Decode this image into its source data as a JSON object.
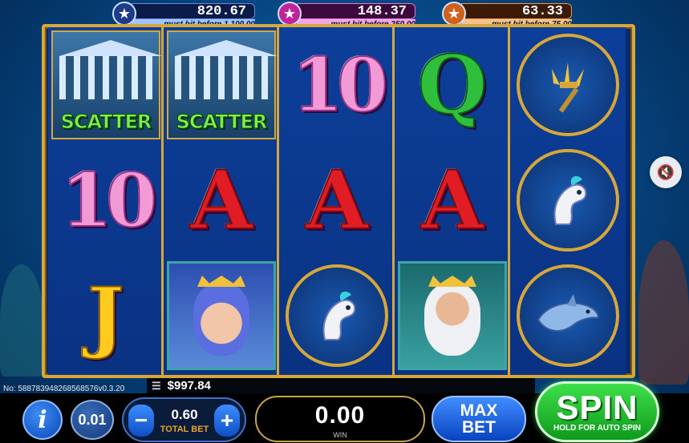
{
  "jackpots": [
    {
      "value": "820.67",
      "sub": "must hit before 1,100.00",
      "color": "#1e3c8c",
      "bar": "#0b1b4a"
    },
    {
      "value": "148.37",
      "sub": "must hit before 250.00",
      "color": "#c0249c",
      "bar": "#3a0a3c"
    },
    {
      "value": "63.33",
      "sub": "must hit before 75.00",
      "color": "#d0601c",
      "bar": "#3c1a06"
    }
  ],
  "reels": [
    [
      {
        "type": "scatter",
        "label": "SCATTER",
        "icon": "temple-icon"
      },
      {
        "type": "letter",
        "value": "10"
      },
      {
        "type": "letter",
        "value": "J"
      }
    ],
    [
      {
        "type": "scatter",
        "label": "SCATTER",
        "icon": "temple-icon"
      },
      {
        "type": "letter",
        "value": "A"
      },
      {
        "type": "portrait",
        "icon": "goddess-icon"
      }
    ],
    [
      {
        "type": "letter",
        "value": "10"
      },
      {
        "type": "letter",
        "value": "A"
      },
      {
        "type": "medallion",
        "icon": "seahorse-icon"
      }
    ],
    [
      {
        "type": "letter",
        "value": "Q"
      },
      {
        "type": "letter",
        "value": "A"
      },
      {
        "type": "portrait",
        "icon": "poseidon-icon"
      }
    ],
    [
      {
        "type": "medallion",
        "icon": "trident-icon"
      },
      {
        "type": "medallion",
        "icon": "seahorse-icon"
      },
      {
        "type": "medallion",
        "icon": "dolphin-icon"
      }
    ]
  ],
  "balance": "$997.84",
  "game_no": "No: 5887839482685685​76v0.3.20",
  "controls": {
    "info": "i",
    "coin_value": "0.01",
    "bet_value": "0.60",
    "bet_label": "TOTAL BET",
    "win_value": "0.00",
    "win_label": "WIN",
    "max_bet_line1": "MAX",
    "max_bet_line2": "BET",
    "spin_label": "SPIN",
    "spin_sub": "HOLD FOR AUTO SPIN",
    "minus": "−",
    "plus": "+"
  },
  "icons": {
    "star": "★",
    "sound": "🔇",
    "stack": "☰"
  }
}
